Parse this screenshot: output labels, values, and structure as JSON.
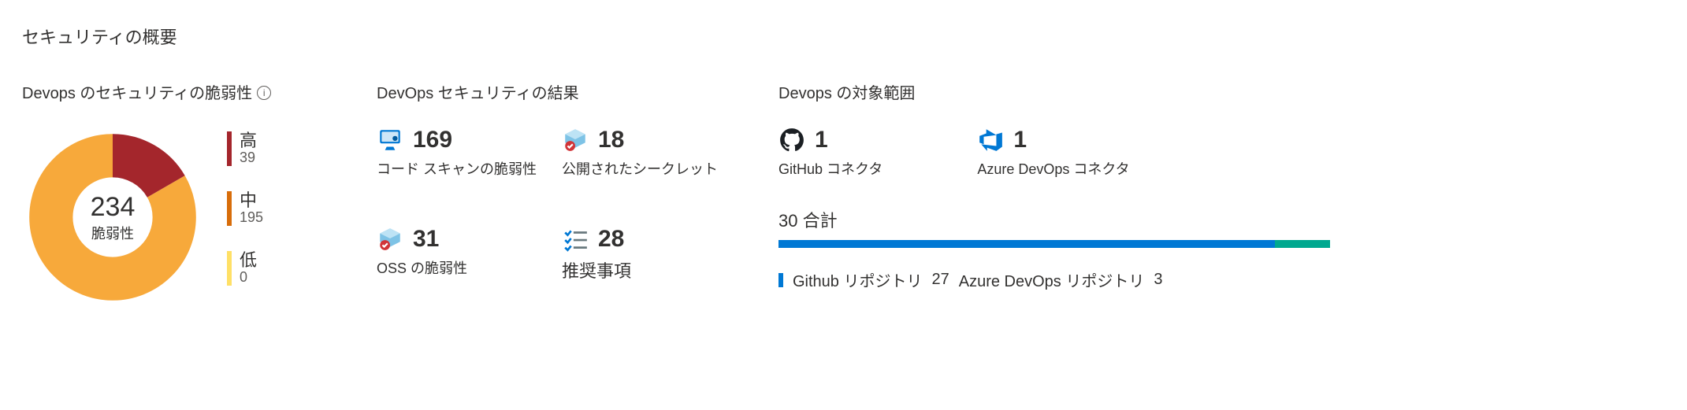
{
  "title": "セキュリティの概要",
  "vuln": {
    "title": "Devops のセキュリティの脆弱性",
    "total": "234",
    "total_label": "脆弱性",
    "legend": [
      {
        "name": "高",
        "value": "39",
        "color": "#a4262c"
      },
      {
        "name": "中",
        "value": "195",
        "color": "#d86d0a"
      },
      {
        "name": "低",
        "value": "0",
        "color": "#ffe066"
      }
    ]
  },
  "results": {
    "title": "DevOps セキュリティの結果",
    "metrics": [
      {
        "value": "169",
        "label": "コード スキャンの脆弱性"
      },
      {
        "value": "18",
        "label": "公開されたシークレット"
      },
      {
        "value": "31",
        "label": "OSS の脆弱性"
      },
      {
        "value": "28",
        "label": "推奨事項"
      }
    ]
  },
  "scope": {
    "title": "Devops の対象範囲",
    "connectors": [
      {
        "value": "1",
        "label": "GitHub コネクタ"
      },
      {
        "value": "1",
        "label": "Azure DevOps コネクタ"
      }
    ],
    "total_text_prefix": "30",
    "total_text_suffix": "合計",
    "segments": [
      {
        "label": "Github リポジトリ",
        "value": "27",
        "color": "#0078d4"
      },
      {
        "label": "Azure  DevOps リポジトリ",
        "value": "3",
        "color": "#00a88f"
      }
    ]
  },
  "chart_data": [
    {
      "type": "pie",
      "title": "Devops のセキュリティの脆弱性",
      "categories": [
        "高",
        "中",
        "低"
      ],
      "values": [
        39,
        195,
        0
      ],
      "total": 234,
      "colors": [
        "#a4262c",
        "#f7a93b",
        "#ffe066"
      ]
    },
    {
      "type": "bar",
      "title": "Devops の対象範囲",
      "categories": [
        "Github リポジトリ",
        "Azure DevOps リポジトリ"
      ],
      "values": [
        27,
        3
      ],
      "total": 30,
      "colors": [
        "#0078d4",
        "#00a88f"
      ]
    }
  ]
}
